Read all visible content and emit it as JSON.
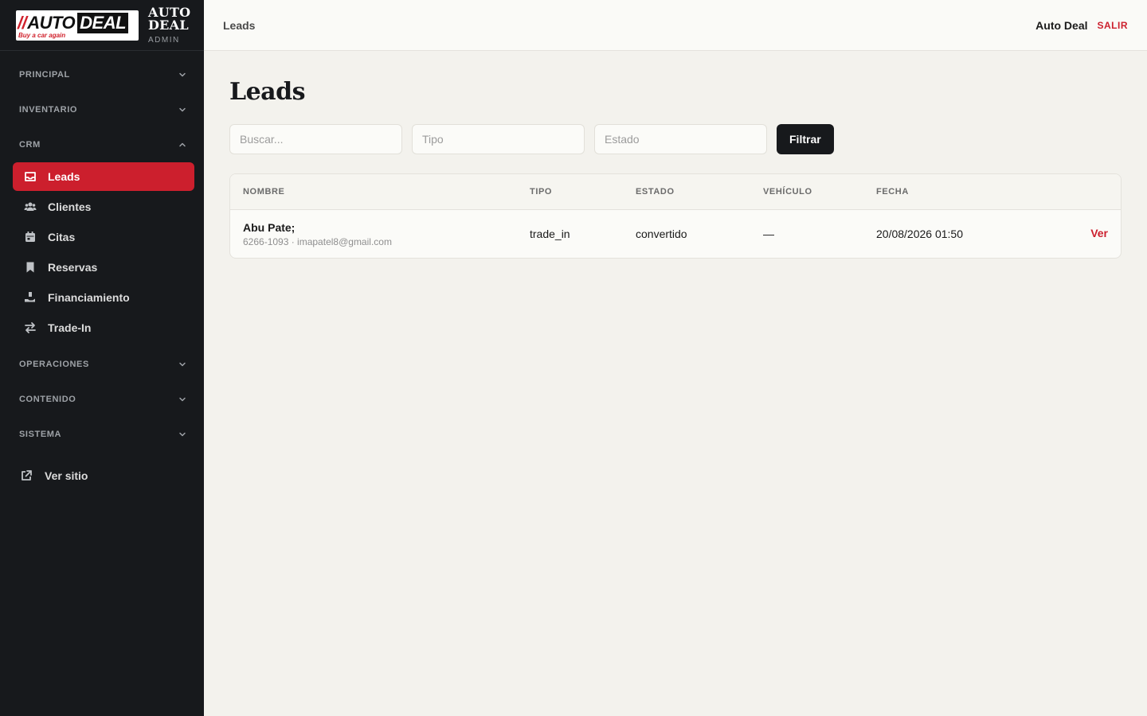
{
  "brand": {
    "logo_prefix": "//",
    "logo_auto": "AUTO",
    "logo_deal": "DEAL",
    "logo_tagline": "Buy a car again",
    "name_line1": "AUTO",
    "name_line2": "DEAL",
    "subtitle": "ADMIN"
  },
  "sidebar": {
    "sections_top": [
      {
        "label": "PRINCIPAL",
        "expanded": false
      },
      {
        "label": "INVENTARIO",
        "expanded": false
      }
    ],
    "crm": {
      "label": "CRM",
      "expanded": true,
      "items": [
        {
          "label": "Leads",
          "icon": "inbox-icon",
          "active": true
        },
        {
          "label": "Clientes",
          "icon": "users-icon",
          "active": false
        },
        {
          "label": "Citas",
          "icon": "calendar-icon",
          "active": false
        },
        {
          "label": "Reservas",
          "icon": "bookmark-icon",
          "active": false
        },
        {
          "label": "Financiamiento",
          "icon": "hand-money-icon",
          "active": false
        },
        {
          "label": "Trade-In",
          "icon": "swap-icon",
          "active": false
        }
      ]
    },
    "sections_bottom": [
      {
        "label": "OPERACIONES",
        "expanded": false
      },
      {
        "label": "CONTENIDO",
        "expanded": false
      },
      {
        "label": "SISTEMA",
        "expanded": false
      }
    ],
    "site_link": {
      "label": "Ver sitio",
      "icon": "external-link-icon"
    }
  },
  "topbar": {
    "breadcrumb": "Leads",
    "user_name": "Auto Deal",
    "logout_label": "SALIR"
  },
  "main": {
    "title": "Leads",
    "filters": {
      "search_placeholder": "Buscar...",
      "type_placeholder": "Tipo",
      "status_placeholder": "Estado",
      "button_label": "Filtrar"
    },
    "table": {
      "columns": [
        "NOMBRE",
        "TIPO",
        "ESTADO",
        "VEHÍCULO",
        "FECHA"
      ],
      "rows": [
        {
          "name": "Abu Pate;",
          "contact": "6266-1093 · imapatel8@gmail.com",
          "type": "trade_in",
          "status": "convertido",
          "vehicle": "—",
          "date": "20/08/2026 01:50",
          "action": "Ver"
        }
      ]
    }
  },
  "colors": {
    "accent": "#cc1f2d",
    "sidebar_bg": "#17191c",
    "page_bg": "#f3f2ed"
  }
}
